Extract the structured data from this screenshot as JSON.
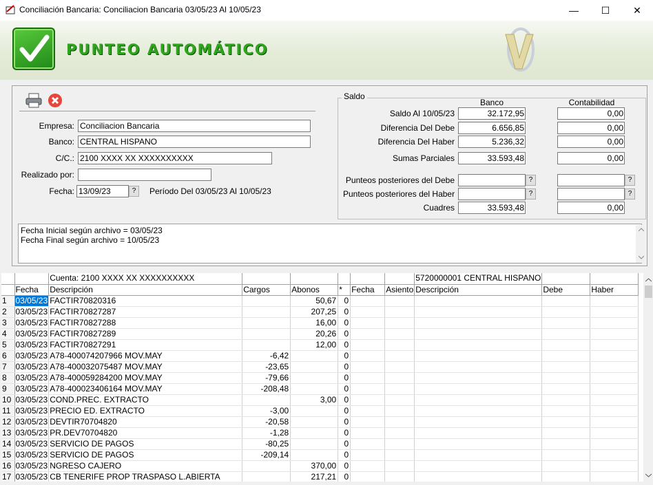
{
  "window": {
    "title": "Conciliación Bancaria: Conciliacion Bancaria   03/05/23 Al 10/05/23",
    "minimize": "—",
    "maximize": "☐",
    "close": "✕"
  },
  "banner": {
    "title": "PUNTEO AUTOMÁTICO"
  },
  "form": {
    "empresa_label": "Empresa:",
    "empresa": "Conciliacion Bancaria",
    "banco_label": "Banco:",
    "banco": "CENTRAL HISPANO",
    "cc_label": "C/C.:",
    "cc": "2100 XXXX XX XXXXXXXXXX",
    "realizado_label": "Realizado por:",
    "realizado": "",
    "fecha_label": "Fecha:",
    "fecha": "13/09/23",
    "fecha_btn": "?",
    "periodo": "Período Del 03/05/23 Al 10/05/23"
  },
  "saldo": {
    "legend": "Saldo",
    "col_banco": "Banco",
    "col_contab": "Contabilidad",
    "rows": [
      {
        "label": "Saldo Al 10/05/23",
        "banco": "32.172,95",
        "contab": "0,00"
      },
      {
        "label": "Diferencia Del Debe",
        "banco": "6.656,85",
        "contab": "0,00"
      },
      {
        "label": "Diferencia Del Haber",
        "banco": "5.236,32",
        "contab": "0,00"
      },
      {
        "label": "Sumas Parciales",
        "banco": "33.593,48",
        "contab": "0,00"
      },
      {
        "label": "Punteos posteriores del Debe",
        "banco": "",
        "contab": ""
      },
      {
        "label": "Punteos posteriores del Haber",
        "banco": "",
        "contab": ""
      },
      {
        "label": "Cuadres",
        "banco": "33.593,48",
        "contab": "0,00"
      }
    ],
    "q": "?"
  },
  "notes": {
    "line1": "Fecha Inicial según archivo = 03/05/23",
    "line2": "Fecha Final según archivo = 10/05/23"
  },
  "grid": {
    "cuenta_left": "Cuenta: 2100  XXXX XX XXXXXXXXXX",
    "cuenta_right": "5720000001 CENTRAL HISPANO",
    "headers": [
      "Fecha",
      "Descripción",
      "Cargos",
      "Abonos",
      "*",
      "Fecha",
      "Asiento",
      "Descripción",
      "Debe",
      "Haber"
    ],
    "rows": [
      [
        "1",
        "03/05/23",
        "FACTIR70820316",
        "",
        "50,67",
        "0"
      ],
      [
        "2",
        "03/05/23",
        "FACTIR70827287",
        "",
        "207,25",
        "0"
      ],
      [
        "3",
        "03/05/23",
        "FACTIR70827288",
        "",
        "16,00",
        "0"
      ],
      [
        "4",
        "03/05/23",
        "FACTIR70827289",
        "",
        "20,26",
        "0"
      ],
      [
        "5",
        "03/05/23",
        "FACTIR70827291",
        "",
        "12,00",
        "0"
      ],
      [
        "6",
        "03/05/23",
        "A78-400074207966 MOV.MAY",
        "-6,42",
        "",
        "0"
      ],
      [
        "7",
        "03/05/23",
        "A78-400032075487 MOV.MAY",
        "-23,65",
        "",
        "0"
      ],
      [
        "8",
        "03/05/23",
        "A78-400059284200 MOV.MAY",
        "-79,66",
        "",
        "0"
      ],
      [
        "9",
        "03/05/23",
        "A78-400023406164 MOV.MAY",
        "-208,48",
        "",
        "0"
      ],
      [
        "10",
        "03/05/23",
        "COND.PREC. EXTRACTO",
        "",
        "3,00",
        "0"
      ],
      [
        "11",
        "03/05/23",
        "PRECIO ED. EXTRACTO",
        "-3,00",
        "",
        "0"
      ],
      [
        "12",
        "03/05/23",
        "DEVTIR70704820",
        "-20,58",
        "",
        "0"
      ],
      [
        "13",
        "03/05/23",
        "PR.DEV70704820",
        "-1,28",
        "",
        "0"
      ],
      [
        "14",
        "03/05/23",
        "SERVICIO DE PAGOS",
        "-80,25",
        "",
        "0"
      ],
      [
        "15",
        "03/05/23",
        "SERVICIO DE PAGOS",
        "-209,14",
        "",
        "0"
      ],
      [
        "16",
        "03/05/23",
        "NGRESO CAJERO",
        "",
        "370,00",
        "0"
      ],
      [
        "17",
        "03/05/23",
        "CB TENERIFE PROP TRASPASO L.ABIERTA",
        "",
        "217,21",
        "0"
      ]
    ]
  }
}
